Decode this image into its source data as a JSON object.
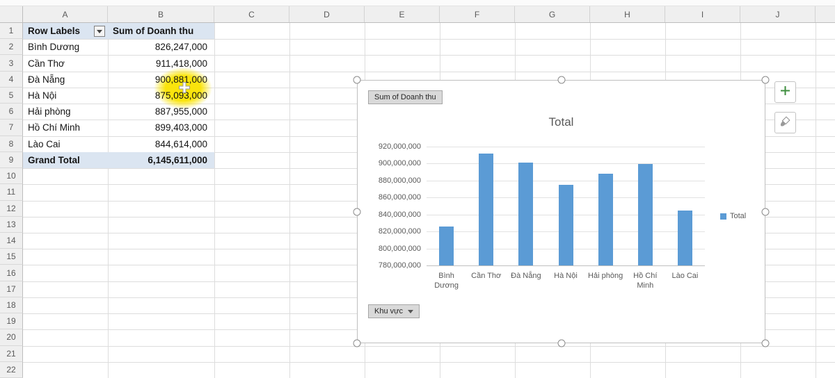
{
  "spreadsheet": {
    "columns": [
      "A",
      "B",
      "C",
      "D",
      "E",
      "F",
      "G",
      "H",
      "I",
      "J"
    ],
    "row_count": 22
  },
  "pivot": {
    "header": {
      "row_labels": "Row Labels",
      "values": "Sum of Doanh thu"
    },
    "rows": [
      {
        "label": "Bình Dương",
        "value": "826,247,000"
      },
      {
        "label": "Cần Thơ",
        "value": "911,418,000"
      },
      {
        "label": "Đà Nẵng",
        "value": "900,881,000"
      },
      {
        "label": "Hà Nội",
        "value": "875,093,000"
      },
      {
        "label": "Hải phòng",
        "value": "887,955,000"
      },
      {
        "label": "Hồ Chí Minh",
        "value": "899,403,000"
      },
      {
        "label": "Lào Cai",
        "value": "844,614,000"
      }
    ],
    "grand_total": {
      "label": "Grand Total",
      "value": "6,145,611,000"
    }
  },
  "chart": {
    "value_field_button": "Sum of Doanh thu",
    "axis_field_button": "Khu vực",
    "legend_label": "Total"
  },
  "chart_data": {
    "type": "bar",
    "title": "Total",
    "categories": [
      "Bình Dương",
      "Cần Thơ",
      "Đà Nẵng",
      "Hà Nội",
      "Hải phòng",
      "Hồ Chí Minh",
      "Lào Cai"
    ],
    "values": [
      826247000,
      911418000,
      900881000,
      875093000,
      887955000,
      899403000,
      844614000
    ],
    "ylim": [
      780000000,
      920000000
    ],
    "ytick_step": 20000000,
    "ytick_labels": [
      "780,000,000",
      "800,000,000",
      "820,000,000",
      "840,000,000",
      "860,000,000",
      "880,000,000",
      "900,000,000",
      "920,000,000"
    ],
    "legend": [
      "Total"
    ],
    "legend_position": "right",
    "grid": true,
    "bar_color": "#5B9BD5"
  },
  "colors": {
    "pivot_header_bg": "#DBE5F1",
    "bar": "#5B9BD5",
    "click_highlight": "#F9E300"
  }
}
